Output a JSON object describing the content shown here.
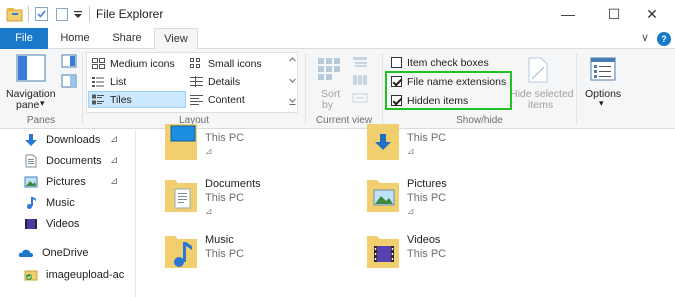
{
  "window": {
    "title": "File Explorer",
    "minimize_glyph": "—",
    "maximize_glyph": "☐",
    "close_glyph": "✕"
  },
  "tabs": [
    {
      "label": "File"
    },
    {
      "label": "Home"
    },
    {
      "label": "Share"
    },
    {
      "label": "View"
    }
  ],
  "ribbon_right": {
    "collapse_glyph": "∨",
    "help_glyph": "?"
  },
  "panes": {
    "nav_pane_label_1": "Navigation",
    "nav_pane_label_2": "pane",
    "dropdown_glyph": "▾",
    "group_label": "Panes"
  },
  "layout": {
    "options": [
      {
        "label": "Medium icons"
      },
      {
        "label": "Small icons"
      },
      {
        "label": "List"
      },
      {
        "label": "Details"
      },
      {
        "label": "Tiles"
      },
      {
        "label": "Content"
      }
    ],
    "selected": "Tiles",
    "group_label": "Layout"
  },
  "current_view": {
    "sort_label": "Sort",
    "sort_sub": "by",
    "group_label": "Current view"
  },
  "show_hide": {
    "item_check_boxes": {
      "label": "Item check boxes",
      "checked": false
    },
    "file_name_extensions": {
      "label": "File name extensions",
      "checked": true
    },
    "hidden_items": {
      "label": "Hidden items",
      "checked": true
    },
    "hide_selected_1": "Hide selected",
    "hide_selected_2": "items",
    "group_label": "Show/hide"
  },
  "options": {
    "label": "Options",
    "dropdown_glyph": "▾"
  },
  "nav_pane": {
    "items": [
      {
        "label": "Downloads",
        "pinned": true
      },
      {
        "label": "Documents",
        "pinned": true
      },
      {
        "label": "Pictures",
        "pinned": true
      },
      {
        "label": "Music",
        "pinned": false
      },
      {
        "label": "Videos",
        "pinned": false
      },
      {
        "label": "OneDrive",
        "pinned": false
      },
      {
        "label": "imageupload-ac",
        "pinned": false
      }
    ],
    "pin_glyph": "📌"
  },
  "content": {
    "tiles": [
      {
        "name": "",
        "location": "This PC",
        "icon": "desktop-folder-icon"
      },
      {
        "name": "",
        "location": "This PC",
        "icon": "downloads-folder-icon"
      },
      {
        "name": "Documents",
        "location": "This PC",
        "icon": "documents-folder-icon"
      },
      {
        "name": "Pictures",
        "location": "This PC",
        "icon": "pictures-folder-icon"
      },
      {
        "name": "Music",
        "location": "This PC",
        "icon": "music-folder-icon"
      },
      {
        "name": "Videos",
        "location": "This PC",
        "icon": "videos-folder-icon"
      }
    ]
  },
  "colors": {
    "file_tab": "#1979ca",
    "highlight_box": "#22c022",
    "selected_layout": "#cce8ff",
    "folder": "#f2cf6e"
  }
}
